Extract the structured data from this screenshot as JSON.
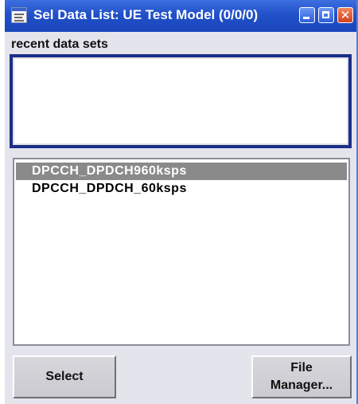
{
  "window": {
    "title": "Sel Data List: UE Test Model (0/0/0)",
    "title_icon": "window-app-icon",
    "controls": {
      "minimize": "minimize-icon",
      "maximize": "maximize-icon",
      "close_glyph": "✕"
    }
  },
  "recent": {
    "label": "recent data sets",
    "items": []
  },
  "list": {
    "items": [
      {
        "label": "DPCCH_DPDCH960ksps",
        "selected": true
      },
      {
        "label": "DPCCH_DPDCH_60ksps",
        "selected": false
      }
    ]
  },
  "buttons": {
    "select": "Select",
    "file_manager_line1": "File",
    "file_manager_line2": "Manager..."
  },
  "colors": {
    "titlebar": "#2150c8",
    "selection": "#8a8a8a",
    "focus_border": "#1b2f8a"
  }
}
